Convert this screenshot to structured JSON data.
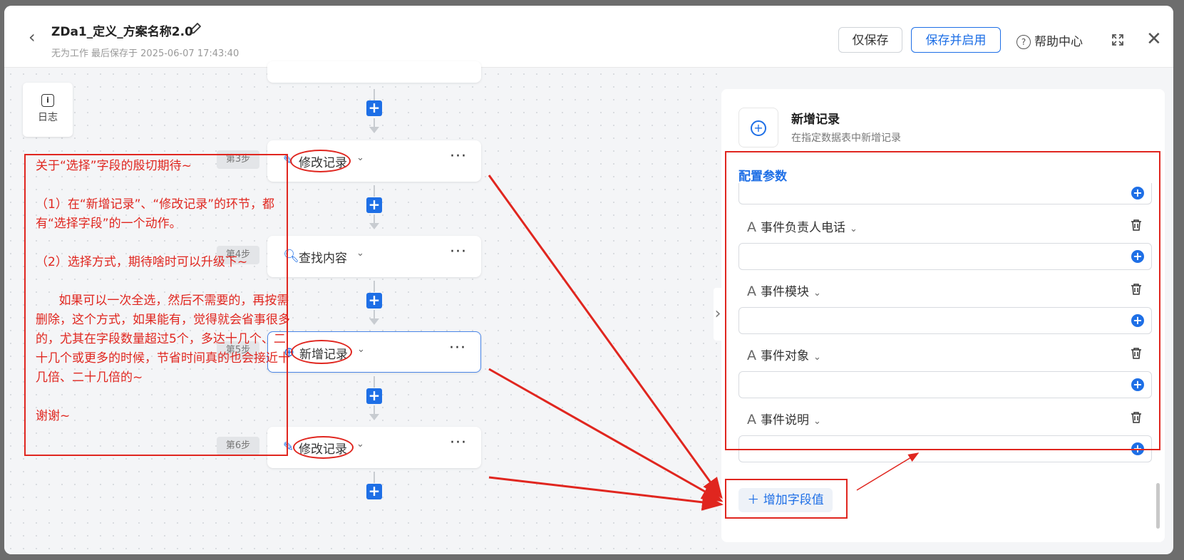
{
  "header": {
    "back_icon": "chevron-left-icon",
    "title": "ZDa1_定义_方案名称2.0",
    "edit_icon": "pencil-icon",
    "subtitle_workspace": "无为工作",
    "subtitle_saved": "最后保存于 2025-06-07 17:43:40",
    "save_only": "仅保存",
    "save_and_enable": "保存并启用",
    "help": "帮助中心",
    "help_icon": "question-circle-icon",
    "expand_icon": "fullscreen-icon",
    "close_icon": "close-icon"
  },
  "sidebar": {
    "log_icon": "info-icon",
    "log_label": "日志"
  },
  "flow": {
    "nodes": [
      {
        "step": "第3步",
        "label": "修改记录",
        "icon": "pencil-icon"
      },
      {
        "step": "第4步",
        "label": "查找内容",
        "icon": "search-doc-icon"
      },
      {
        "step": "第5步",
        "label": "新增记录",
        "icon": "plus-circle-icon"
      },
      {
        "step": "第6步",
        "label": "修改记录",
        "icon": "pencil-icon"
      }
    ],
    "more": "···",
    "plus": "+"
  },
  "annotation": {
    "text": "关于“选择”字段的殷切期待~\n\n（1）在“新增记录”、“修改记录”的环节，都有“选择字段”的一个动作。\n\n（2）选择方式，期待啥时可以升级下~\n\n      如果可以一次全选，然后不需要的，再按需删除，这个方式，如果能有，觉得就会省事很多的，尤其在字段数量超过5个，多达十几个、二十几个或更多的时候，节省时间真的也会接近十几倍、二十几倍的~\n\n谢谢~",
    "color": "#e0261f"
  },
  "panel": {
    "icon": "plus-circle-icon",
    "title": "新增记录",
    "subtitle": "在指定数据表中新增记录",
    "tab": "配置参数",
    "fields": [
      {
        "label": "事件负责人电话",
        "type_icon": "text-type-icon"
      },
      {
        "label": "事件模块",
        "type_icon": "text-type-icon"
      },
      {
        "label": "事件对象",
        "type_icon": "text-type-icon"
      },
      {
        "label": "事件说明",
        "type_icon": "text-type-icon"
      }
    ],
    "add_field": "增加字段值",
    "accent": "#1e6fe6"
  }
}
